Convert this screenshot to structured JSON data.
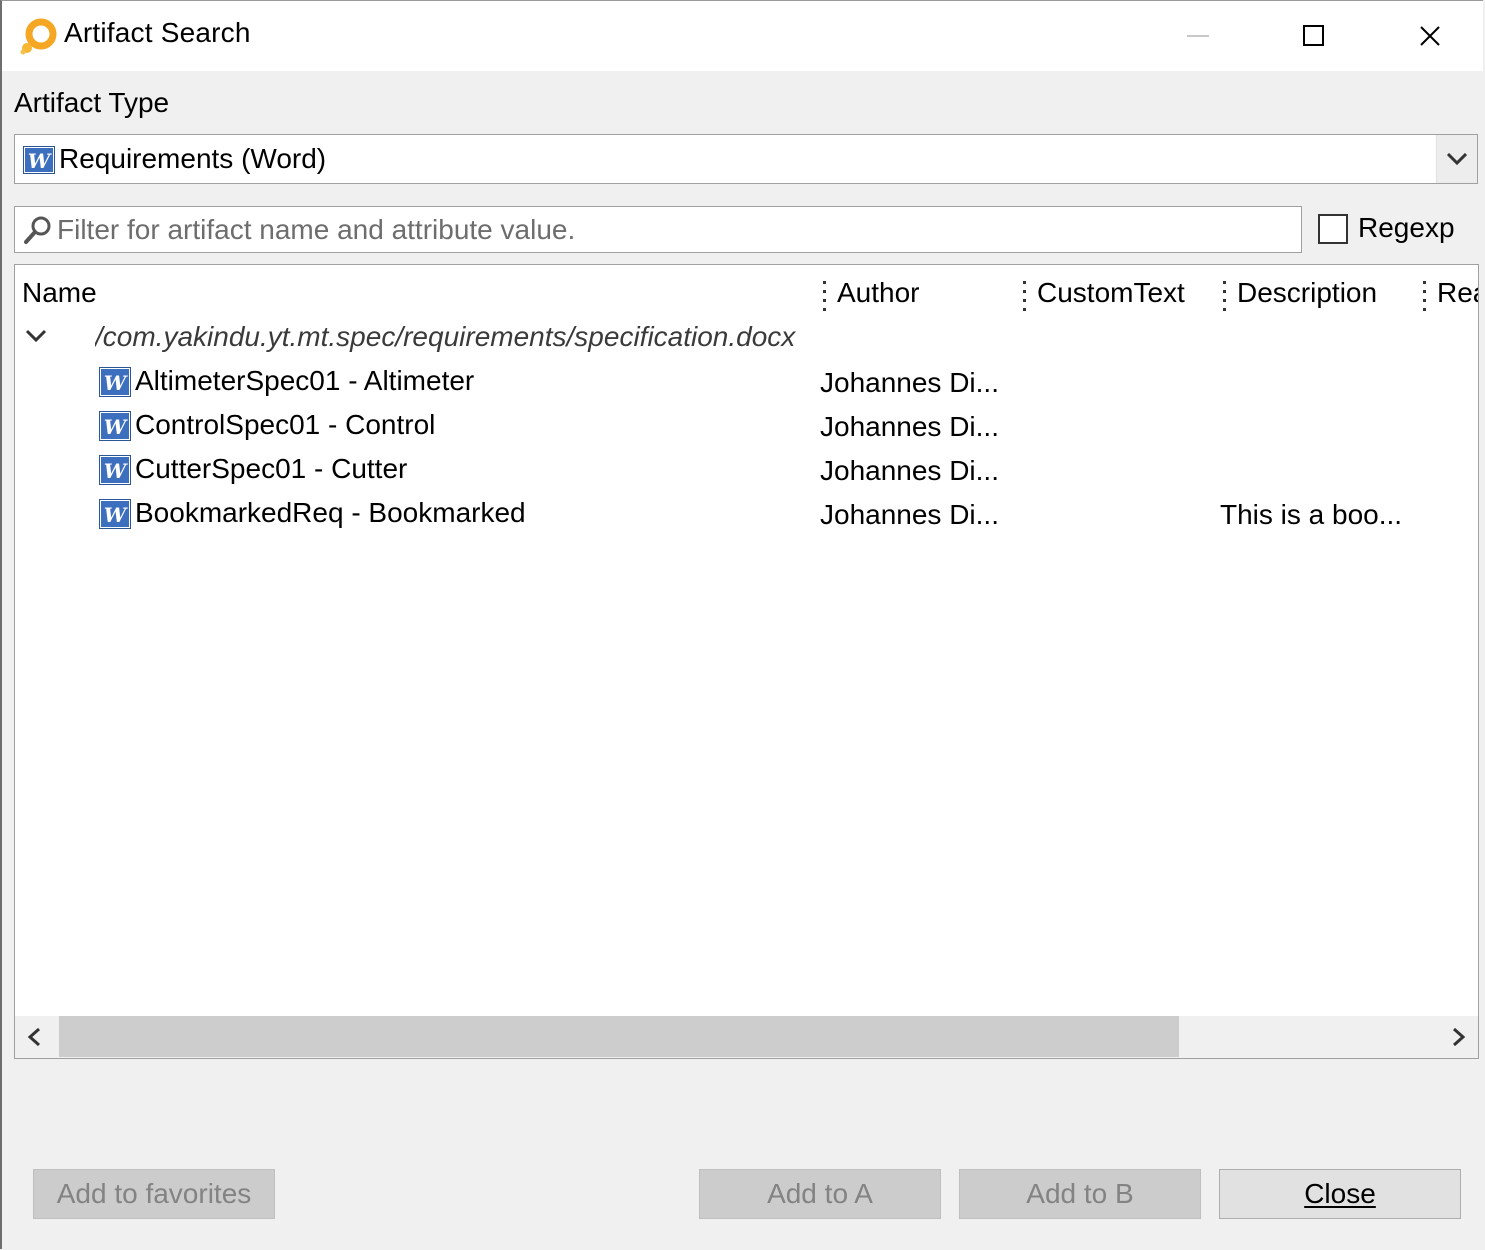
{
  "window": {
    "title": "Artifact Search",
    "icon": "yakindu-ring-icon"
  },
  "artifact_type": {
    "label": "Artifact Type",
    "selected": "Requirements (Word)",
    "icon": "word-document-icon"
  },
  "filter": {
    "placeholder": "Filter for artifact name and attribute value.",
    "value": "",
    "regexp_label": "Regexp",
    "regexp_checked": false
  },
  "table": {
    "columns": [
      "Name",
      "Author",
      "CustomText",
      "Description",
      "Rea"
    ],
    "group_path": "/com.yakindu.yt.mt.spec/requirements/specification.docx",
    "rows": [
      {
        "name": "AltimeterSpec01 - Altimeter",
        "author": "Johannes Di...",
        "description": ""
      },
      {
        "name": "ControlSpec01 - Control",
        "author": "Johannes Di...",
        "description": ""
      },
      {
        "name": "CutterSpec01 - Cutter",
        "author": "Johannes Di...",
        "description": ""
      },
      {
        "name": "BookmarkedReq - Bookmarked",
        "author": "Johannes Di...",
        "description": "This is a boo..."
      }
    ]
  },
  "buttons": {
    "add_favorites": "Add to favorites",
    "add_a": "Add to A",
    "add_b": "Add to B",
    "close": "Close"
  },
  "colors": {
    "accent_orange": "#f39c12",
    "word_blue": "#2b5797",
    "disabled_button": "#cccccc"
  }
}
